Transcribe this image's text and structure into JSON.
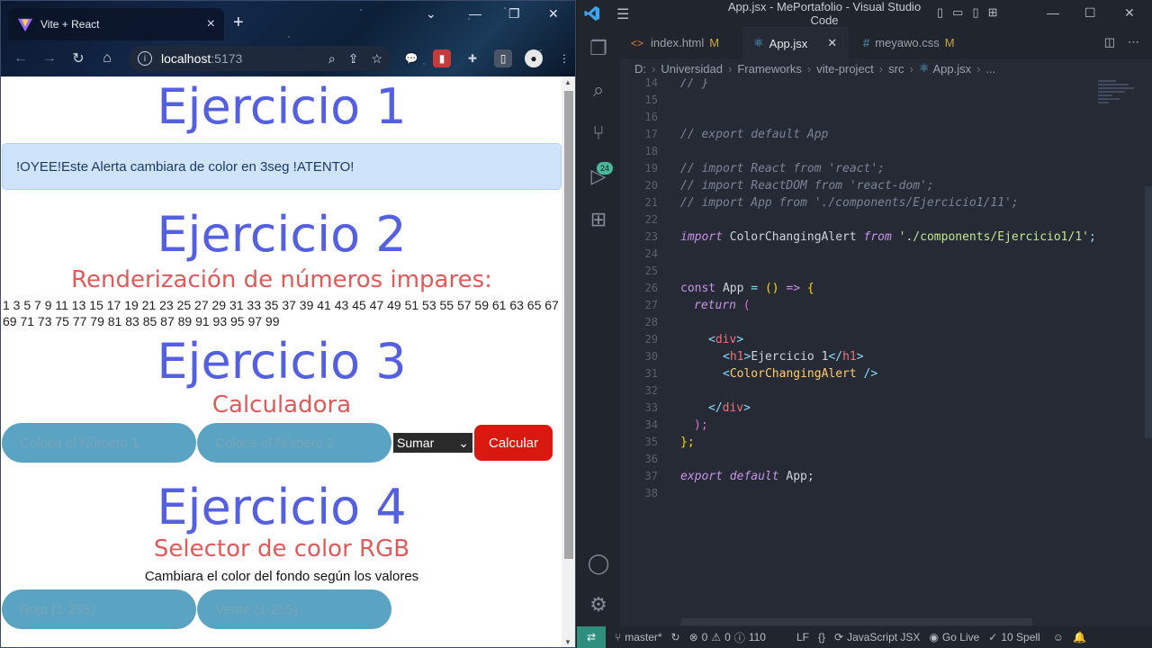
{
  "browser": {
    "tab_title": "Vite + React",
    "tab_close": "×",
    "new_tab": "+",
    "url_host": "localhost",
    "url_port": ":5173",
    "icons": [
      "back-icon",
      "forward-icon",
      "reload-icon",
      "home-icon",
      "info-icon",
      "zoom-icon",
      "share-icon",
      "star-icon"
    ]
  },
  "page": {
    "ej1_title": "Ejercicio 1",
    "alert_text": "!OYEE!Este Alerta cambiara de color en 3seg !ATENTO!",
    "ej2_title": "Ejercicio 2",
    "ej2_subtitle": "Renderización de números impares:",
    "odd_numbers_line1": "1 3 5 7 9 11 13 15 17 19 21 23 25 27 29 31 33 35 37 39 41 43 45 47 49 51 53 55 57 59 61 63 65 67",
    "odd_numbers_line2": "69 71 73 75 77 79 81 83 85 87 89 91 93 95 97 99",
    "ej3_title": "Ejercicio 3",
    "ej3_subtitle": "Calculadora",
    "input1_placeholder": "Coloca el Número 1",
    "input2_placeholder": "Coloca el Número 2",
    "operation_selected": "Sumar",
    "calc_button": "Calcular",
    "ej4_title": "Ejercicio 4",
    "ej4_subtitle": "Selector de color RGB",
    "ej4_caption": "Cambiara el color del fondo según los valores",
    "red_placeholder": "Rojo (1-255)",
    "green_placeholder": "Verde (1-255)"
  },
  "vscode": {
    "window_title": "App.jsx - MePortafolio - Visual Studio Code",
    "tabs": [
      {
        "label": "index.html",
        "flag": "M",
        "icon": "html-icon"
      },
      {
        "label": "App.jsx",
        "flag": "",
        "icon": "react-icon"
      },
      {
        "label": "meyawo.css",
        "flag": "M",
        "icon": "css-icon"
      }
    ],
    "breadcrumb": [
      "D:",
      "Universidad",
      "Frameworks",
      "vite-project",
      "src",
      "App.jsx",
      "..."
    ],
    "scm_badge": "24",
    "lines": {
      "l14": "14",
      "l15": "15",
      "l16": "16",
      "l17": "17",
      "l18": "18",
      "l19": "19",
      "l20": "20",
      "l21": "21",
      "l22": "22",
      "l23": "23",
      "l24": "24",
      "l25": "25",
      "l26": "26",
      "l27": "27",
      "l28": "28",
      "l29": "29",
      "l30": "30",
      "l31": "31",
      "l32": "32",
      "l33": "33",
      "l34": "34",
      "l35": "35",
      "l36": "36",
      "l37": "37",
      "l38": "38"
    },
    "code": {
      "c14": "// }",
      "c17": "// export default App",
      "c19": "// import React from 'react';",
      "c20": "// import ReactDOM from 'react-dom';",
      "c21": "// import App from './components/Ejercicio1/11';",
      "c23_kw": "import",
      "c23_id": " ColorChangingAlert ",
      "c23_from": "from",
      "c23_str": " './components/Ejercicio1/1'",
      "c23_end": ";",
      "c26_const": "const",
      "c26_app": " App ",
      "c26_eq": "= ",
      "c26_paren": "()",
      "c26_arrow": " => ",
      "c26_brace": "{",
      "c27_return": "return",
      "c27_paren": " (",
      "c29_open": "<",
      "c29_tag": "div",
      "c29_close": ">",
      "c30_open": "<",
      "c30_tag": "h1",
      "c30_mid": ">",
      "c30_text": "Ejercicio 1",
      "c30_end_open": "</",
      "c30_end_tag": "h1",
      "c30_end_close": ">",
      "c31_open": "<",
      "c31_tag": "ColorChangingAlert",
      "c31_close": " />",
      "c33_open": "</",
      "c33_tag": "div",
      "c33_close": ">",
      "c34": ");",
      "c35": "};",
      "c37_kw": "export default",
      "c37_id": " App;"
    },
    "status": {
      "branch": "master*",
      "errors": "0",
      "warnings": "0",
      "info": "110",
      "eol": "LF",
      "language": "JavaScript JSX",
      "go_live": "Go Live",
      "spell": "10 Spell"
    }
  }
}
